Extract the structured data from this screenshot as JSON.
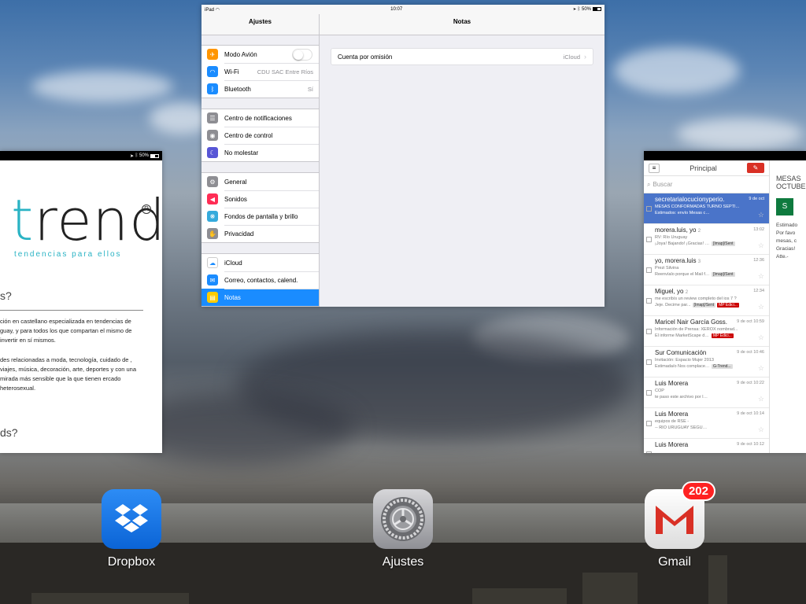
{
  "trends_card": {
    "status_battery": "50%",
    "logo_t": "t",
    "logo_rest": "rends",
    "logo_reg": "R",
    "tagline": "tendencias para ellos",
    "q1": "s?",
    "para1": "ción en castellano especializada en tendencias de guay, y para todos los que compartan el mismo de invertir en sí mismos.",
    "para2": "des relacionadas a moda, tecnología, cuidado de , viajes, música, decoración, arte, deportes y con una mirada más sensible que la que tienen ercado heterosexual.",
    "q2": "ds?"
  },
  "ajustes_card": {
    "status_left": "iPad",
    "status_time": "10:07",
    "status_battery": "50%",
    "left_title": "Ajustes",
    "right_title": "Notas",
    "groups": [
      [
        {
          "label": "Modo Avión",
          "icon": "airplane-icon",
          "glyph": "✈",
          "color": "#ff9500"
        },
        {
          "label": "Wi-Fi",
          "value": "CDU SAC Entre Ríos",
          "icon": "wifi-icon",
          "glyph": "◠",
          "color": "#1a8cff"
        },
        {
          "label": "Bluetooth",
          "value": "Sí",
          "icon": "bluetooth-icon",
          "glyph": "ᛒ",
          "color": "#1a8cff"
        }
      ],
      [
        {
          "label": "Centro de notificaciones",
          "icon": "notifications-icon",
          "glyph": "☰",
          "color": "#8e8e93"
        },
        {
          "label": "Centro de control",
          "icon": "control-center-icon",
          "glyph": "◉",
          "color": "#8e8e93"
        },
        {
          "label": "No molestar",
          "icon": "moon-icon",
          "glyph": "☾",
          "color": "#5856d6"
        }
      ],
      [
        {
          "label": "General",
          "icon": "gear-icon",
          "glyph": "⚙",
          "color": "#8e8e93"
        },
        {
          "label": "Sonidos",
          "icon": "speaker-icon",
          "glyph": "◀",
          "color": "#ff2d55"
        },
        {
          "label": "Fondos de pantalla y brillo",
          "icon": "wallpaper-icon",
          "glyph": "❋",
          "color": "#34aadc"
        },
        {
          "label": "Privacidad",
          "icon": "hand-icon",
          "glyph": "✋",
          "color": "#8e8e93"
        }
      ],
      [
        {
          "label": "iCloud",
          "icon": "cloud-icon",
          "glyph": "☁",
          "color": "#ffffff"
        },
        {
          "label": "Correo, contactos, calend.",
          "icon": "mail-icon",
          "glyph": "✉",
          "color": "#1a8cff"
        },
        {
          "label": "Notas",
          "icon": "notes-icon",
          "glyph": "▤",
          "color": "#ffcc00"
        }
      ]
    ],
    "notes_option": {
      "label": "Cuenta por omisión",
      "value": "iCloud"
    }
  },
  "gmail_card": {
    "header_title": "Principal",
    "search_placeholder": "Buscar",
    "detail_line1": "MESAS",
    "detail_line2": "OCTUBE",
    "detail_avatar": "S",
    "detail_text": "Estimado Por favo mesas, c Gracias! Atte.-",
    "items": [
      {
        "from": "secretarialocucionyperio.",
        "count": "",
        "time": "9 de oct",
        "subject": "MESAS CONFORMADAS TURNO SEPTI...",
        "snippet": "Estimados: envío Mesas conformadas par...",
        "labels": []
      },
      {
        "from": "morera.luis, yo",
        "count": "2",
        "time": "13:02",
        "subject": "RV: Río Uruguay",
        "snippet": "¡Joya! Bajando! ¡Gracias! El ju...",
        "labels": [
          {
            "t": "[Imap]/Sent",
            "red": false
          }
        ]
      },
      {
        "from": "yo, morera.luis",
        "count": "3",
        "time": "12:36",
        "subject": "Prezi Silvina",
        "snippet": "Reenvíalo porque el Mail fue s...",
        "labels": [
          {
            "t": "[Imap]/Sent",
            "red": false
          }
        ]
      },
      {
        "from": "Miguel, yo",
        "count": "2",
        "time": "12:34",
        "subject": "me escribís un review completo del ios 7 ?",
        "snippet": "Jeje. Decime par...",
        "labels": [
          {
            "t": "[Imap]/Sent",
            "red": false
          },
          {
            "t": "MP Edici...",
            "red": true
          }
        ]
      },
      {
        "from": "Maricel Nair García Goss.",
        "count": "",
        "time": "9 de oct 10:59",
        "subject": "Información de Prensa: XEROX nombrad...",
        "snippet": "El informe MarketScape de ID...",
        "labels": [
          {
            "t": "MP Edici...",
            "red": true
          }
        ]
      },
      {
        "from": "Sur Comunicación",
        "count": "",
        "time": "9 de oct 10:46",
        "subject": "Invitación: Espacio Mujer 2013",
        "snippet": "Estimada/o Nos complace invi...",
        "labels": [
          {
            "t": "G-Trend...",
            "red": false
          }
        ]
      },
      {
        "from": "Luis Morera",
        "count": "",
        "time": "9 de oct 10:22",
        "subject": "COP",
        "snippet": "te paso este archivo por las dudas -- RIO ...",
        "labels": []
      },
      {
        "from": "Luis Morera",
        "count": "",
        "time": "9 de oct 10:14",
        "subject": "equipos de RSE -",
        "snippet": "-- RIO URUGUAY SEGUROS Lic. Luis Mor...",
        "labels": []
      },
      {
        "from": "Luis Morera",
        "count": "",
        "time": "9 de oct 10:12",
        "subject": "",
        "snippet": "",
        "labels": []
      }
    ]
  },
  "dock": {
    "apps": [
      {
        "label": "Dropbox",
        "icon": "dropbox-icon"
      },
      {
        "label": "Ajustes",
        "icon": "settings-gear-icon"
      },
      {
        "label": "Gmail",
        "icon": "gmail-icon",
        "badge": "202"
      }
    ]
  }
}
